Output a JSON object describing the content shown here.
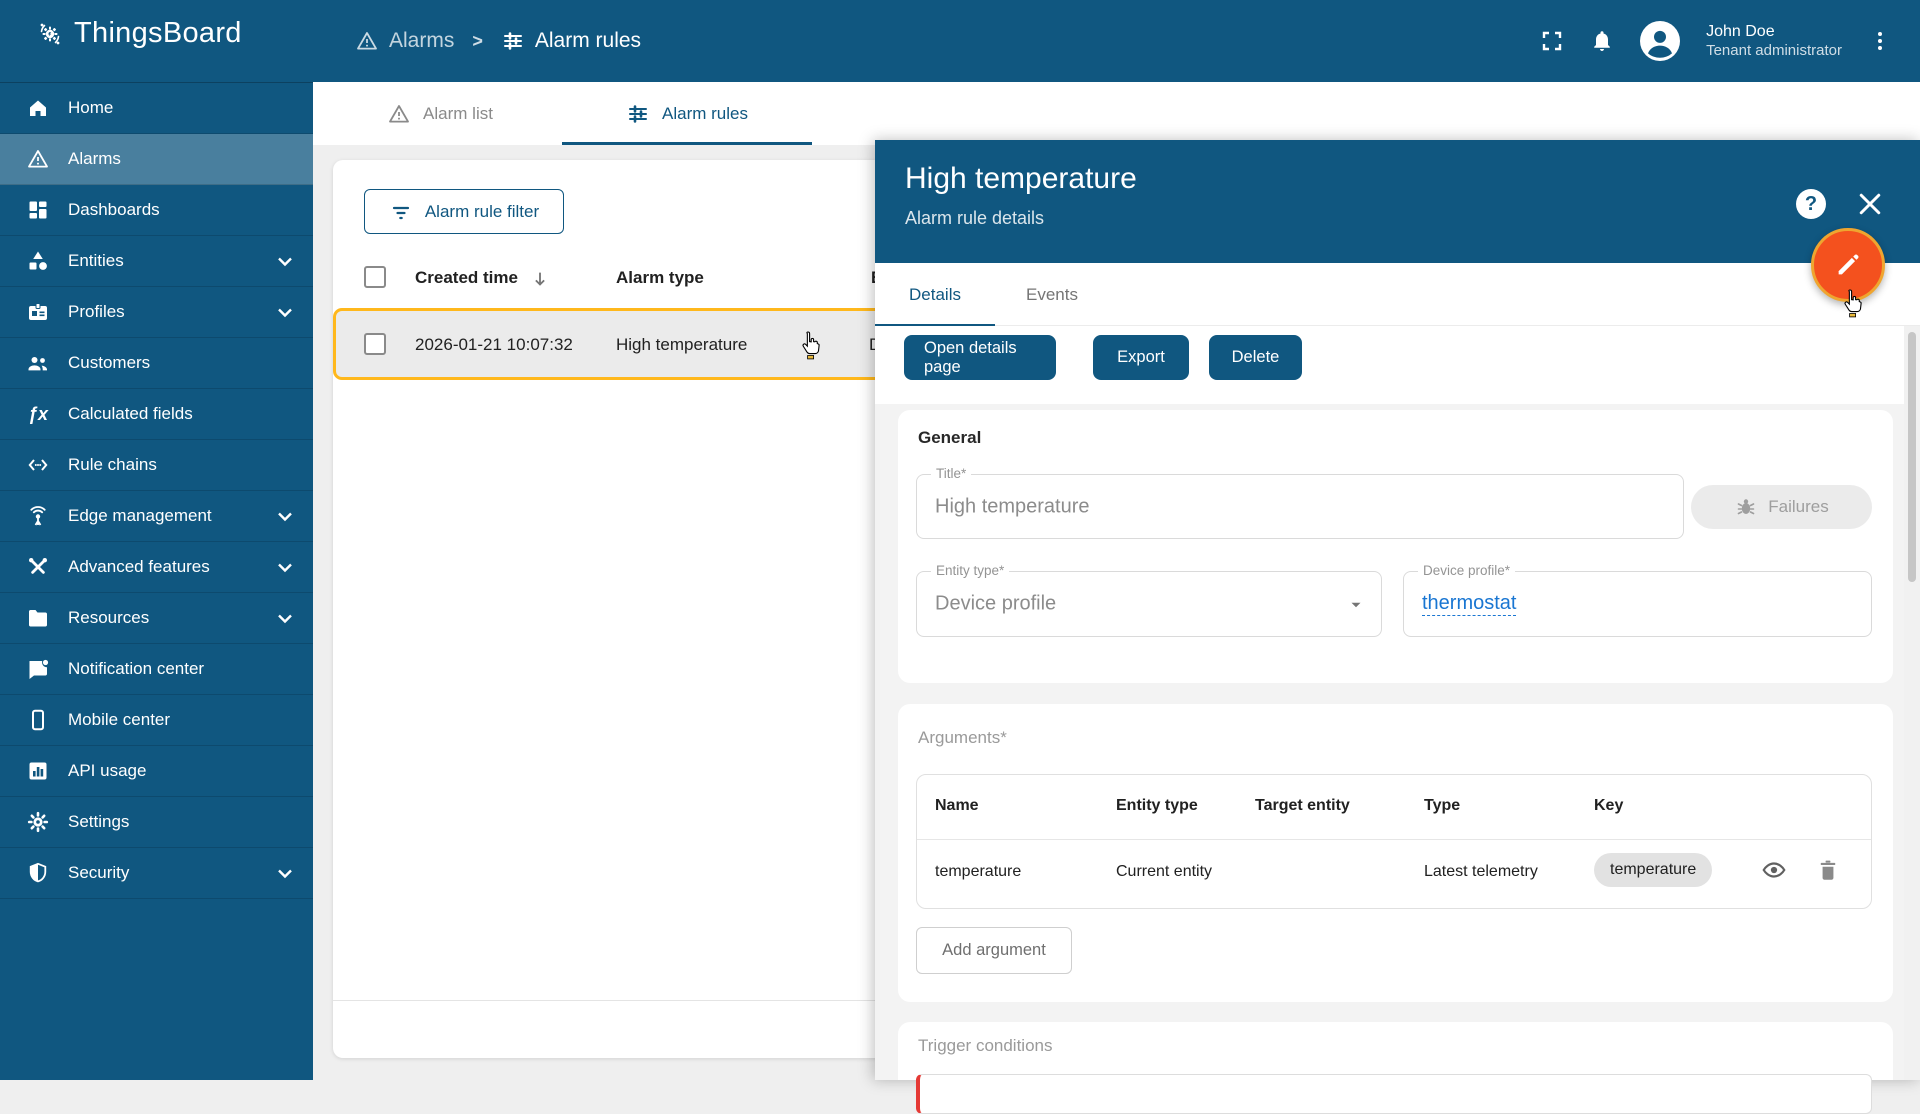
{
  "app": {
    "title": "ThingsBoard"
  },
  "header": {
    "breadcrumb": {
      "separator": ">",
      "items": [
        {
          "label": "Alarms"
        },
        {
          "label": "Alarm rules"
        }
      ]
    },
    "user": {
      "name": "John Doe",
      "role": "Tenant administrator"
    }
  },
  "sidebar": {
    "items": [
      {
        "label": "Home"
      },
      {
        "label": "Alarms"
      },
      {
        "label": "Dashboards"
      },
      {
        "label": "Entities"
      },
      {
        "label": "Profiles"
      },
      {
        "label": "Customers"
      },
      {
        "label": "Calculated fields"
      },
      {
        "label": "Rule chains"
      },
      {
        "label": "Edge management"
      },
      {
        "label": "Advanced features"
      },
      {
        "label": "Resources"
      },
      {
        "label": "Notification center"
      },
      {
        "label": "Mobile center"
      },
      {
        "label": "API usage"
      },
      {
        "label": "Settings"
      },
      {
        "label": "Security"
      }
    ]
  },
  "tabs": {
    "alarm_list": "Alarm list",
    "alarm_rules": "Alarm rules"
  },
  "toolbar": {
    "filter_label": "Alarm rule filter"
  },
  "table": {
    "col_created_time": "Created time",
    "col_alarm_type": "Alarm type",
    "col_truncated": "E",
    "row": {
      "created_time": "2026-01-21 10:07:32",
      "alarm_type": "High temperature",
      "truncated": "D"
    }
  },
  "panel": {
    "title": "High temperature",
    "subtitle": "Alarm rule details",
    "tab_details": "Details",
    "tab_events": "Events",
    "btn_open": "Open details page",
    "btn_export": "Export",
    "btn_delete": "Delete",
    "help_glyph": "?",
    "general": {
      "heading": "General",
      "title_label": "Title*",
      "title_value": "High temperature",
      "failures_label": "Failures",
      "entity_type_label": "Entity type*",
      "entity_type_value": "Device profile",
      "device_profile_label": "Device profile*",
      "device_profile_value": "thermostat"
    },
    "arguments": {
      "heading": "Arguments*",
      "col_name": "Name",
      "col_entity_type": "Entity type",
      "col_target_entity": "Target entity",
      "col_type": "Type",
      "col_key": "Key",
      "row": {
        "name": "temperature",
        "entity_type": "Current entity",
        "target_entity": "",
        "type": "Latest telemetry",
        "key": "temperature"
      },
      "add_label": "Add argument"
    },
    "trigger_heading": "Trigger conditions"
  },
  "icon_glyphs": {
    "fx": "ƒx"
  },
  "colors": {
    "primary": "#105780",
    "fab": "#F4511E",
    "fab_ring": "#EFA52F",
    "row_highlight": "#FFB81C",
    "link": "#1976D2"
  }
}
